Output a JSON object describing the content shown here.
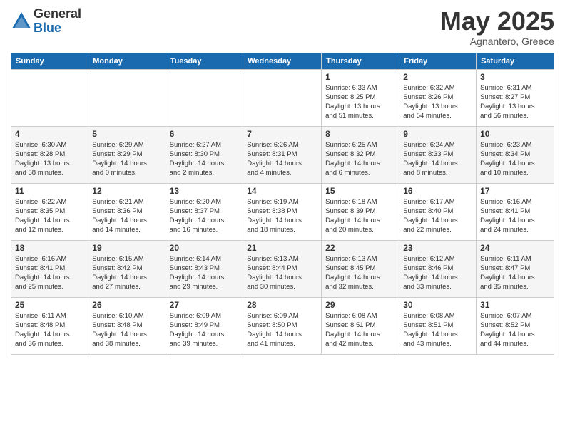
{
  "header": {
    "logo_general": "General",
    "logo_blue": "Blue",
    "month_title": "May 2025",
    "subtitle": "Agnantero, Greece"
  },
  "weekdays": [
    "Sunday",
    "Monday",
    "Tuesday",
    "Wednesday",
    "Thursday",
    "Friday",
    "Saturday"
  ],
  "weeks": [
    [
      {
        "day": "",
        "info": ""
      },
      {
        "day": "",
        "info": ""
      },
      {
        "day": "",
        "info": ""
      },
      {
        "day": "",
        "info": ""
      },
      {
        "day": "1",
        "info": "Sunrise: 6:33 AM\nSunset: 8:25 PM\nDaylight: 13 hours\nand 51 minutes."
      },
      {
        "day": "2",
        "info": "Sunrise: 6:32 AM\nSunset: 8:26 PM\nDaylight: 13 hours\nand 54 minutes."
      },
      {
        "day": "3",
        "info": "Sunrise: 6:31 AM\nSunset: 8:27 PM\nDaylight: 13 hours\nand 56 minutes."
      }
    ],
    [
      {
        "day": "4",
        "info": "Sunrise: 6:30 AM\nSunset: 8:28 PM\nDaylight: 13 hours\nand 58 minutes."
      },
      {
        "day": "5",
        "info": "Sunrise: 6:29 AM\nSunset: 8:29 PM\nDaylight: 14 hours\nand 0 minutes."
      },
      {
        "day": "6",
        "info": "Sunrise: 6:27 AM\nSunset: 8:30 PM\nDaylight: 14 hours\nand 2 minutes."
      },
      {
        "day": "7",
        "info": "Sunrise: 6:26 AM\nSunset: 8:31 PM\nDaylight: 14 hours\nand 4 minutes."
      },
      {
        "day": "8",
        "info": "Sunrise: 6:25 AM\nSunset: 8:32 PM\nDaylight: 14 hours\nand 6 minutes."
      },
      {
        "day": "9",
        "info": "Sunrise: 6:24 AM\nSunset: 8:33 PM\nDaylight: 14 hours\nand 8 minutes."
      },
      {
        "day": "10",
        "info": "Sunrise: 6:23 AM\nSunset: 8:34 PM\nDaylight: 14 hours\nand 10 minutes."
      }
    ],
    [
      {
        "day": "11",
        "info": "Sunrise: 6:22 AM\nSunset: 8:35 PM\nDaylight: 14 hours\nand 12 minutes."
      },
      {
        "day": "12",
        "info": "Sunrise: 6:21 AM\nSunset: 8:36 PM\nDaylight: 14 hours\nand 14 minutes."
      },
      {
        "day": "13",
        "info": "Sunrise: 6:20 AM\nSunset: 8:37 PM\nDaylight: 14 hours\nand 16 minutes."
      },
      {
        "day": "14",
        "info": "Sunrise: 6:19 AM\nSunset: 8:38 PM\nDaylight: 14 hours\nand 18 minutes."
      },
      {
        "day": "15",
        "info": "Sunrise: 6:18 AM\nSunset: 8:39 PM\nDaylight: 14 hours\nand 20 minutes."
      },
      {
        "day": "16",
        "info": "Sunrise: 6:17 AM\nSunset: 8:40 PM\nDaylight: 14 hours\nand 22 minutes."
      },
      {
        "day": "17",
        "info": "Sunrise: 6:16 AM\nSunset: 8:41 PM\nDaylight: 14 hours\nand 24 minutes."
      }
    ],
    [
      {
        "day": "18",
        "info": "Sunrise: 6:16 AM\nSunset: 8:41 PM\nDaylight: 14 hours\nand 25 minutes."
      },
      {
        "day": "19",
        "info": "Sunrise: 6:15 AM\nSunset: 8:42 PM\nDaylight: 14 hours\nand 27 minutes."
      },
      {
        "day": "20",
        "info": "Sunrise: 6:14 AM\nSunset: 8:43 PM\nDaylight: 14 hours\nand 29 minutes."
      },
      {
        "day": "21",
        "info": "Sunrise: 6:13 AM\nSunset: 8:44 PM\nDaylight: 14 hours\nand 30 minutes."
      },
      {
        "day": "22",
        "info": "Sunrise: 6:13 AM\nSunset: 8:45 PM\nDaylight: 14 hours\nand 32 minutes."
      },
      {
        "day": "23",
        "info": "Sunrise: 6:12 AM\nSunset: 8:46 PM\nDaylight: 14 hours\nand 33 minutes."
      },
      {
        "day": "24",
        "info": "Sunrise: 6:11 AM\nSunset: 8:47 PM\nDaylight: 14 hours\nand 35 minutes."
      }
    ],
    [
      {
        "day": "25",
        "info": "Sunrise: 6:11 AM\nSunset: 8:48 PM\nDaylight: 14 hours\nand 36 minutes."
      },
      {
        "day": "26",
        "info": "Sunrise: 6:10 AM\nSunset: 8:48 PM\nDaylight: 14 hours\nand 38 minutes."
      },
      {
        "day": "27",
        "info": "Sunrise: 6:09 AM\nSunset: 8:49 PM\nDaylight: 14 hours\nand 39 minutes."
      },
      {
        "day": "28",
        "info": "Sunrise: 6:09 AM\nSunset: 8:50 PM\nDaylight: 14 hours\nand 41 minutes."
      },
      {
        "day": "29",
        "info": "Sunrise: 6:08 AM\nSunset: 8:51 PM\nDaylight: 14 hours\nand 42 minutes."
      },
      {
        "day": "30",
        "info": "Sunrise: 6:08 AM\nSunset: 8:51 PM\nDaylight: 14 hours\nand 43 minutes."
      },
      {
        "day": "31",
        "info": "Sunrise: 6:07 AM\nSunset: 8:52 PM\nDaylight: 14 hours\nand 44 minutes."
      }
    ]
  ]
}
